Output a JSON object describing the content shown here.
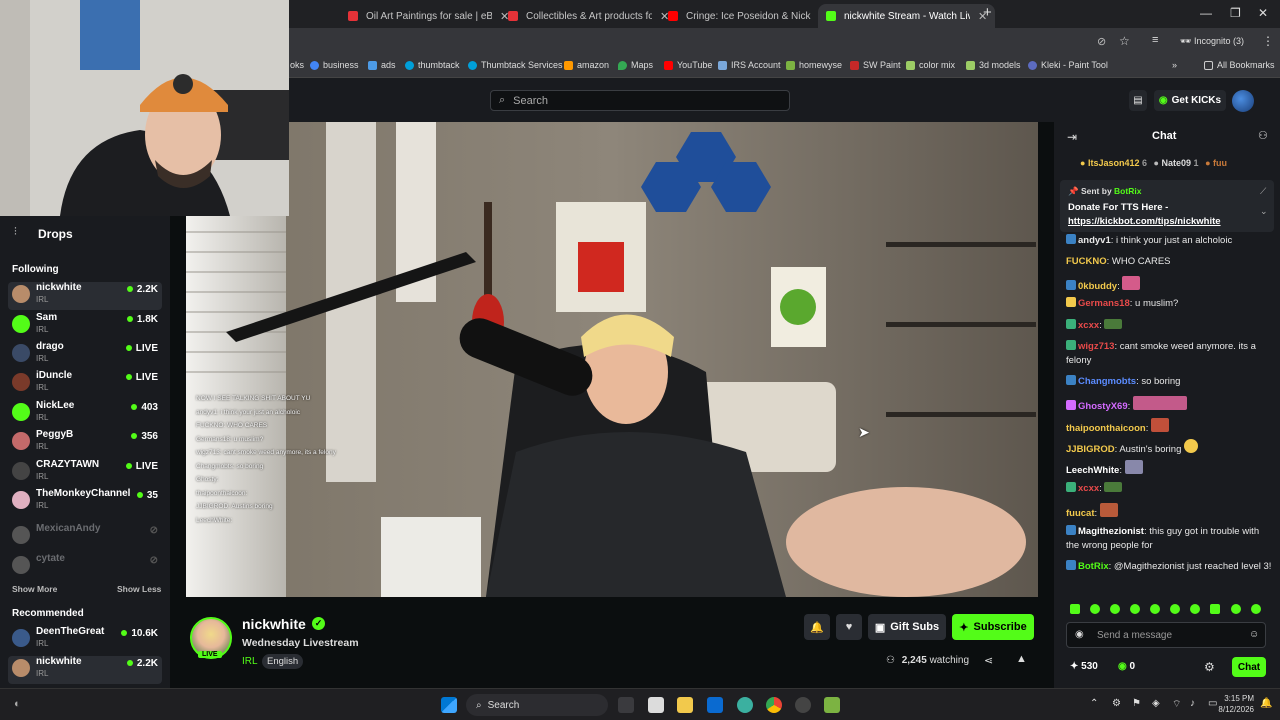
{
  "browser": {
    "tabs": [
      {
        "label": "Oil Art Paintings for sale | eBay",
        "color": "#e53238"
      },
      {
        "label": "Collectibles & Art products for",
        "color": "#e53238"
      },
      {
        "label": "Cringe: Ice Poseidon & Nick W",
        "color": "#ff0000"
      },
      {
        "label": "nickwhite Stream - Watch Live",
        "color": "#53fc18"
      }
    ],
    "profile": "Incognito (3)",
    "bookmarks": [
      "oks",
      "business",
      "ads",
      "thumbtack",
      "Thumbtack Services",
      "amazon",
      "Maps",
      "YouTube",
      "IRS Account",
      "homewyse",
      "SW Paint",
      "color mix",
      "3d models",
      "Kleki - Paint Tool"
    ],
    "all_bookmarks": "All Bookmarks"
  },
  "header": {
    "search_placeholder": "Search",
    "get_kicks": "Get KICKs"
  },
  "sidebar": {
    "drops": "Drops",
    "following_title": "Following",
    "following": [
      {
        "name": "nickwhite",
        "category": "IRL",
        "viewers": "2.2K",
        "selected": true,
        "color": "#b88c6a"
      },
      {
        "name": "Sam",
        "category": "IRL",
        "viewers": "1.8K",
        "color": "#53fc18"
      },
      {
        "name": "drago",
        "category": "IRL",
        "viewers": "LIVE",
        "color": "#3a4a66"
      },
      {
        "name": "iDuncle",
        "category": "IRL",
        "viewers": "LIVE",
        "color": "#7a3a2a"
      },
      {
        "name": "NickLee",
        "category": "IRL",
        "viewers": "403",
        "color": "#53fc18"
      },
      {
        "name": "PeggyB",
        "category": "IRL",
        "viewers": "356",
        "color": "#c46a6a"
      },
      {
        "name": "CRAZYTAWN",
        "category": "IRL",
        "viewers": "LIVE",
        "color": "#444"
      },
      {
        "name": "TheMonkeyChannel",
        "category": "IRL",
        "viewers": "35",
        "color": "#e0b0c0"
      },
      {
        "name": "MexicanAndy",
        "category": "",
        "viewers": "",
        "offline": true,
        "color": "#555"
      },
      {
        "name": "cytate",
        "category": "",
        "viewers": "",
        "offline": true,
        "color": "#555"
      }
    ],
    "show_more": "Show More",
    "show_less": "Show Less",
    "recommended_title": "Recommended",
    "recommended": [
      {
        "name": "DeenTheGreat",
        "category": "IRL",
        "viewers": "10.6K",
        "color": "#3a5a8a"
      },
      {
        "name": "nickwhite",
        "category": "IRL",
        "viewers": "2.2K",
        "selected": true,
        "color": "#b88c6a"
      }
    ]
  },
  "video": {
    "overlay_lines": [
      "NOW I SEE TALKING SHIT ABOUT YU",
      "andyv1: i think your just an alcholoic",
      "FUCKNO: WHO CARES",
      "Germans18: u muslim?",
      "wigz713: cant smoke weed anymore, its a felony",
      "Changmobts: so boring",
      "Ghosty: ",
      "thaipoonthaicoon: ",
      "JJBIGROD: Austins boring",
      "LeechWhite: "
    ]
  },
  "stream": {
    "channel": "nickwhite",
    "title": "Wednesday Livestream",
    "category": "IRL",
    "language": "English",
    "live_badge": "LIVE",
    "watching_count": "2,245",
    "watching_label": "watching",
    "gift_subs": "Gift Subs",
    "subscribe": "Subscribe"
  },
  "chat": {
    "title": "Chat",
    "top_gifters": [
      {
        "name": "ItsJason412",
        "count": "6"
      },
      {
        "name": "Nate09",
        "count": "1"
      },
      {
        "name": "fuu",
        "count": ""
      }
    ],
    "pinned": {
      "sent_by": "Sent by",
      "author": "BotRix",
      "text": "Donate For TTS Here -",
      "link": "https://kickbot.com/tips/nickwhite"
    },
    "messages": [
      {
        "user": "andyv1",
        "color": "#e8e8e8",
        "text": "i think your just an alcholoic"
      },
      {
        "user": "FUCKNO",
        "color": "#f2c94c",
        "text": "WHO CARES"
      },
      {
        "user": "0kbuddy",
        "color": "#f2c94c",
        "text": ""
      },
      {
        "user": "Germans18",
        "color": "#e84a4a",
        "text": "u muslim?"
      },
      {
        "user": "xcxx",
        "color": "#e84a4a",
        "text": ""
      },
      {
        "user": "wigz713",
        "color": "#e84a4a",
        "text": "cant smoke weed anymore. its a felony"
      },
      {
        "user": "Changmobts",
        "color": "#5b8cff",
        "text": "so boring"
      },
      {
        "user": "GhostyX69",
        "color": "#d46bff",
        "text": ""
      },
      {
        "user": "thaipoonthaicoon",
        "color": "#f2c94c",
        "text": ""
      },
      {
        "user": "JJBIGROD",
        "color": "#f2c94c",
        "text": "Austin's boring"
      },
      {
        "user": "LeechWhite",
        "color": "#ffffff",
        "text": ""
      },
      {
        "user": "xcxx",
        "color": "#e84a4a",
        "text": ""
      },
      {
        "user": "fuucat",
        "color": "#f2c94c",
        "text": ""
      },
      {
        "user": "Magithezionist",
        "color": "#ffffff",
        "text": "this guy got in trouble with the wrong people for"
      },
      {
        "user": "BotRix",
        "color": "#53fc18",
        "text": "@Magithezionist just reached level 3!"
      }
    ],
    "input_placeholder": "Send a message",
    "points": "530",
    "kicks": "0",
    "send": "Chat"
  },
  "taskbar": {
    "search": "Search",
    "time": "3:15 PM",
    "date": "8/12/2026"
  }
}
